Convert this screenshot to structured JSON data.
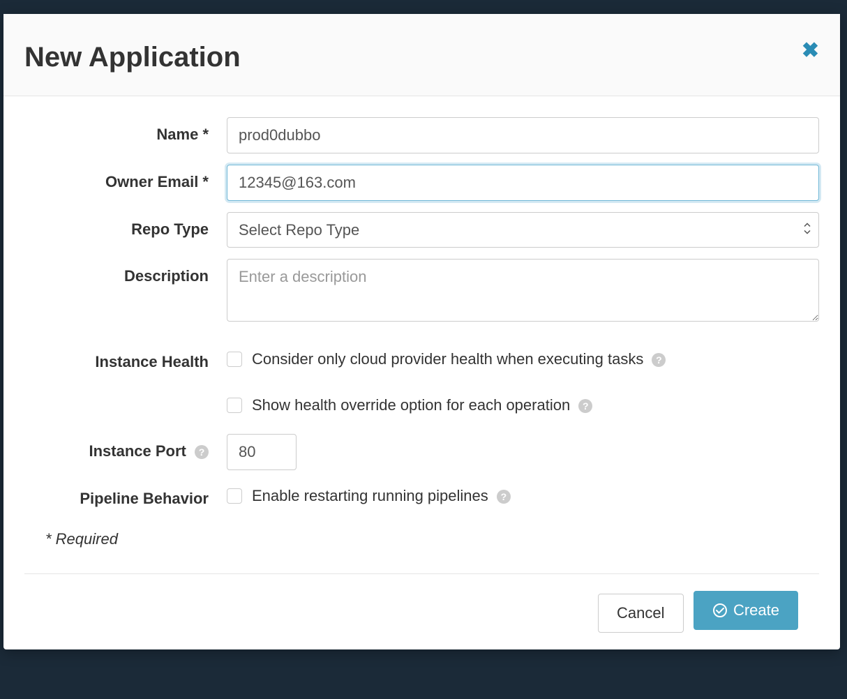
{
  "modal": {
    "title": "New Application"
  },
  "form": {
    "name": {
      "label": "Name *",
      "value": "prod0dubbo"
    },
    "owner_email": {
      "label": "Owner Email *",
      "value": "12345@163.com"
    },
    "repo_type": {
      "label": "Repo Type",
      "placeholder": "Select Repo Type"
    },
    "description": {
      "label": "Description",
      "placeholder": "Enter a description",
      "value": ""
    },
    "instance_health": {
      "label": "Instance Health",
      "option1": "Consider only cloud provider health when executing tasks",
      "option2": "Show health override option for each operation"
    },
    "instance_port": {
      "label": "Instance Port",
      "value": "80"
    },
    "pipeline_behavior": {
      "label": "Pipeline Behavior",
      "option1": "Enable restarting running pipelines"
    },
    "required_note": "* Required"
  },
  "footer": {
    "cancel": "Cancel",
    "create": "Create"
  }
}
